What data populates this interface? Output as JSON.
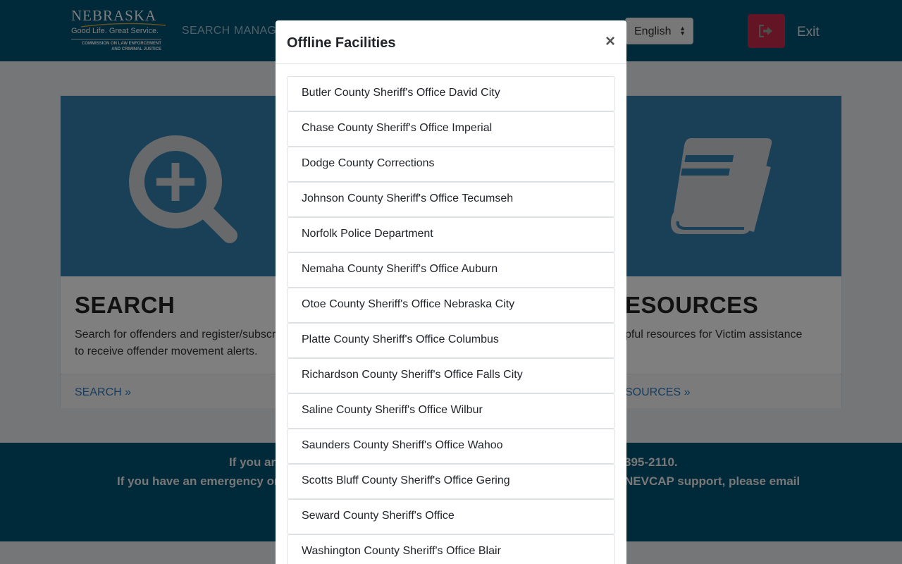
{
  "header": {
    "logo_title": "NEBRASKA",
    "logo_tagline": "Good Life. Great Service.",
    "logo_commission_1": "COMMISSION ON LAW ENFORCEMENT",
    "logo_commission_2": "AND CRIMINAL JUSTICE",
    "nav": [
      {
        "label": "SEARCH"
      },
      {
        "label": "MANAG"
      }
    ],
    "language": "English",
    "exit_icon": "sign-out-icon",
    "exit_label": "Exit"
  },
  "cards": {
    "search": {
      "icon": "search-plus-icon",
      "title": "SEARCH",
      "text_line1": "Search for offenders and register/subscri",
      "text_line2": "to receive offender movement alerts.",
      "link": "SEARCH »"
    },
    "resources": {
      "icon": "book-icon",
      "title": "ESOURCES",
      "text_line1": "pful resources for Victim assistance",
      "link": "SOURCES »"
    }
  },
  "footer": {
    "line1_left": "If you ar",
    "line1_right": "395-2110.",
    "line2_left": "If you have an emergency or",
    "line2_right": "NEVCAP support, please email"
  },
  "modal": {
    "title": "Offline Facilities",
    "close_symbol": "×",
    "items": [
      "Butler County Sheriff's Office David City",
      "Chase County Sheriff's Office Imperial",
      "Dodge County Corrections",
      "Johnson County Sheriff's Office Tecumseh",
      "Norfolk Police Department",
      "Nemaha County Sheriff's Office Auburn",
      "Otoe County Sheriff's Office Nebraska City",
      "Platte County Sheriff's Office Columbus",
      "Richardson County Sheriff's Office Falls City",
      "Saline County Sheriff's Office Wilbur",
      "Saunders County Sheriff's Office Wahoo",
      "Scotts Bluff County Sheriff's Office Gering",
      "Seward County Sheriff's Office",
      "Washington County Sheriff's Office Blair"
    ]
  },
  "colors": {
    "header_bg": "#005273",
    "card_image_bg": "#3580b0",
    "exit_button": "#c82b4a",
    "link": "#2c7ac0"
  }
}
